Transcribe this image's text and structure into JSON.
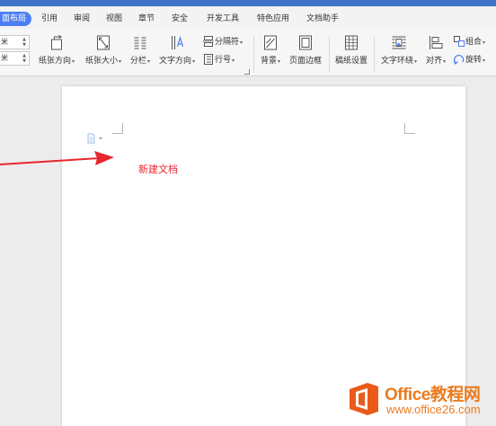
{
  "menu": {
    "tabs": [
      {
        "label": "面布局",
        "active": true
      },
      {
        "label": "引用"
      },
      {
        "label": "审阅"
      },
      {
        "label": "视图"
      },
      {
        "label": "章节"
      },
      {
        "label": "安全"
      },
      {
        "label": "开发工具"
      },
      {
        "label": "特色应用"
      },
      {
        "label": "文档助手"
      }
    ]
  },
  "ribbon": {
    "margin_top": "米",
    "margin_bottom": "米",
    "paper_orientation": "纸张方向",
    "paper_size": "纸张大小",
    "columns": "分栏",
    "text_direction": "文字方向",
    "separator": "分隔符",
    "line_number": "行号",
    "background": "背景",
    "page_border": "页面边框",
    "manuscript_setup": "稿纸设置",
    "text_wrap": "文字环绕",
    "align": "对齐",
    "group": "组合",
    "rotate": "旋转"
  },
  "document": {
    "annotation": "新建文档"
  },
  "watermark": {
    "title": "Office教程网",
    "subtitle": "www.office26.com"
  },
  "colors": {
    "accent": "#4c7ef3",
    "annotation": "#e8262d",
    "watermark": "#ea7b1e"
  }
}
